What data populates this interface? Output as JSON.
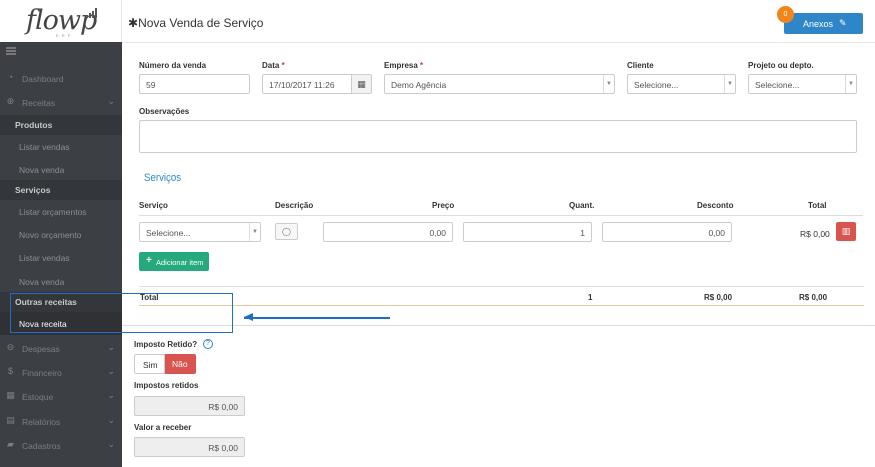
{
  "sidebar": {
    "logo": "flowp",
    "logo_sub": "E R P",
    "items": {
      "dashboard": "Dashboard",
      "receitas": "Receitas",
      "produtos": "Produtos",
      "listar_vendas": "Listar vendas",
      "nova_venda_produto": "Nova venda",
      "servicos": "Serviços",
      "listar_orcamentos": "Listar orçamentos",
      "novo_orcamento": "Novo orçamento",
      "listar_vendas_servico": "Listar vendas",
      "nova_venda_servico": "Nova venda",
      "outras_receitas": "Outras receitas",
      "nova_receita": "Nova receita",
      "despesas": "Despesas",
      "financeiro": "Financeiro",
      "estoque": "Estoque",
      "relatorios": "Relatórios",
      "cadastros": "Cadastros"
    }
  },
  "header": {
    "title": "Nova Venda de Serviço",
    "anexos_label": "Anexos",
    "anexos_count": "0"
  },
  "form": {
    "numero_label": "Número da venda",
    "numero_value": "59",
    "data_label": "Data",
    "data_value": "17/10/2017 11:26",
    "empresa_label": "Empresa",
    "empresa_value": "Demo Agência",
    "cliente_label": "Cliente",
    "cliente_value": "Selecione...",
    "projeto_label": "Projeto ou depto.",
    "projeto_value": "Selecione...",
    "obs_label": "Observações",
    "required_mark": "*"
  },
  "servicos": {
    "title": "Serviços",
    "headers": {
      "servico": "Serviço",
      "descricao": "Descrição",
      "preco": "Preço",
      "quant": "Quant.",
      "desconto": "Desconto",
      "total": "Total"
    },
    "row": {
      "servico": "Selecione...",
      "preco": "0,00",
      "quant": "1",
      "desconto": "0,00",
      "total": "R$ 0,00"
    },
    "add_label": "Adicionar item",
    "totals": {
      "label": "Total",
      "quant": "1",
      "desconto": "R$ 0,00",
      "total": "R$ 0,00"
    }
  },
  "impostos": {
    "retido_label": "Imposto Retido?",
    "sim": "Sim",
    "nao": "Não",
    "retidos_label": "Impostos retidos",
    "retidos_value": "R$ 0,00",
    "receber_label": "Valor a receber",
    "receber_value": "R$ 0,00"
  },
  "colors": {
    "accent": "#2e86c9",
    "sidebar_bg": "#3c3f44",
    "success": "#26a97d",
    "danger": "#d9534f",
    "badge": "#f0861a"
  }
}
